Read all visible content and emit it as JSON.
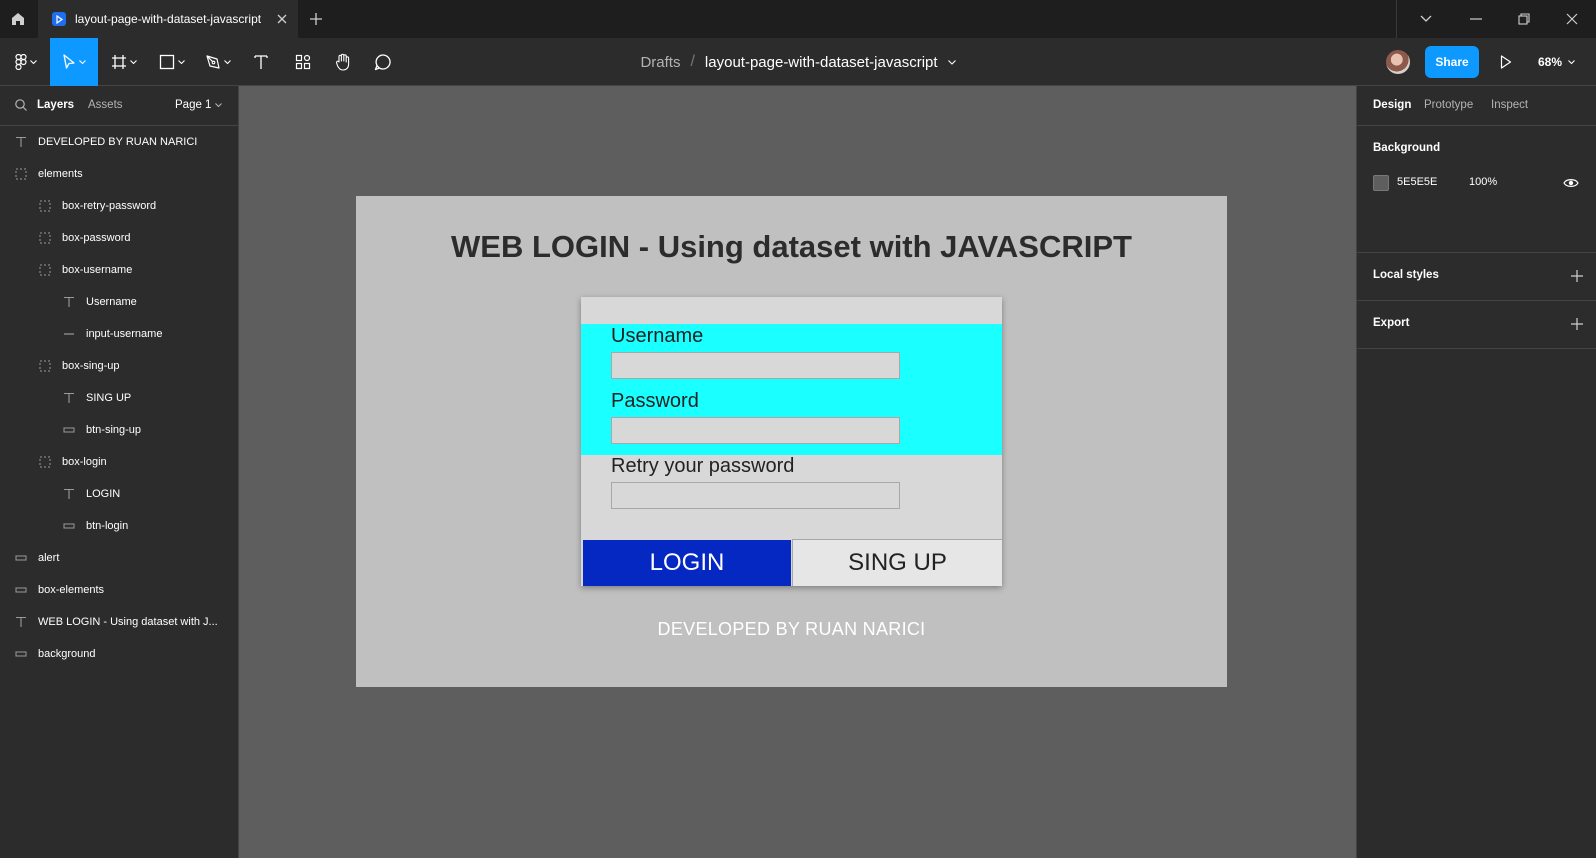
{
  "titlebar": {
    "tab_title": "layout-page-with-dataset-javascript"
  },
  "toolbar": {
    "breadcrumb_drafts": "Drafts",
    "breadcrumb_sep": "/",
    "file_name": "layout-page-with-dataset-javascript",
    "share_label": "Share",
    "zoom": "68%"
  },
  "left_panel": {
    "tab_layers": "Layers",
    "tab_assets": "Assets",
    "page": "Page 1",
    "layers": [
      {
        "label": "DEVELOPED BY RUAN NARICI",
        "icon": "text-icon"
      },
      {
        "label": "elements",
        "icon": "group-icon"
      },
      {
        "label": "box-retry-password",
        "icon": "group-icon"
      },
      {
        "label": "box-password",
        "icon": "group-icon"
      },
      {
        "label": "box-username",
        "icon": "group-icon"
      },
      {
        "label": "Username",
        "icon": "text-icon"
      },
      {
        "label": "input-username",
        "icon": "line-icon"
      },
      {
        "label": "box-sing-up",
        "icon": "group-icon"
      },
      {
        "label": "SING UP",
        "icon": "text-icon"
      },
      {
        "label": "btn-sing-up",
        "icon": "rectangle-icon"
      },
      {
        "label": "box-login",
        "icon": "group-icon"
      },
      {
        "label": "LOGIN",
        "icon": "text-icon"
      },
      {
        "label": "btn-login",
        "icon": "rectangle-icon"
      },
      {
        "label": "alert",
        "icon": "rectangle-icon"
      },
      {
        "label": "box-elements",
        "icon": "rectangle-icon"
      },
      {
        "label": "WEB LOGIN - Using dataset with J...",
        "icon": "text-icon"
      },
      {
        "label": "background",
        "icon": "rectangle-icon"
      }
    ]
  },
  "canvas": {
    "background_color": "#5e5e5e",
    "frame_title": "WEB LOGIN - Using dataset with JAVASCRIPT",
    "username_label": "Username",
    "password_label": "Password",
    "retry_label": "Retry your password",
    "login_button": "LOGIN",
    "signup_button": "SING UP",
    "developed_by": "DEVELOPED BY RUAN NARICI",
    "help": "?"
  },
  "right_panel": {
    "tab_design": "Design",
    "tab_prototype": "Prototype",
    "tab_inspect": "Inspect",
    "background_heading": "Background",
    "background_hex": "5E5E5E",
    "background_opacity": "100%",
    "local_styles_heading": "Local styles",
    "export_heading": "Export"
  },
  "colors": {
    "accent": "#0d99ff",
    "cyan_band": "#1affff",
    "login_button": "#0527c2"
  }
}
